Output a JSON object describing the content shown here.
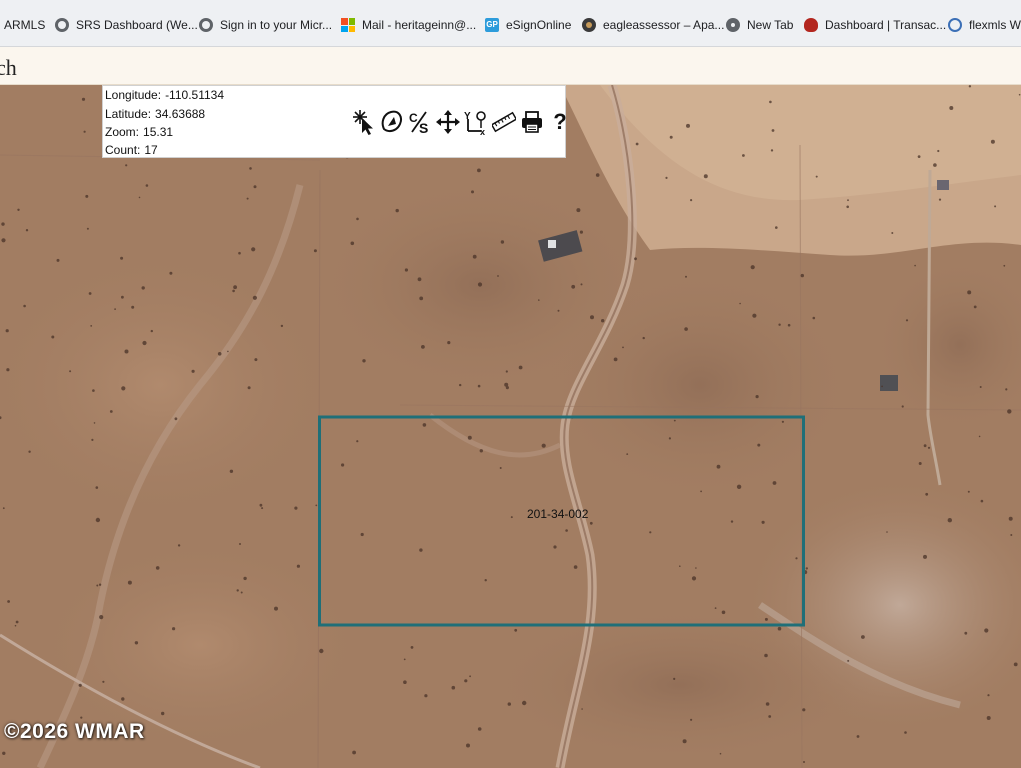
{
  "bookmarks": [
    {
      "label": "ARMLS",
      "icon": "none"
    },
    {
      "label": "SRS Dashboard (We...",
      "icon": "globe-icon"
    },
    {
      "label": "Sign in to your Micr...",
      "icon": "globe-icon"
    },
    {
      "label": "Mail - heritageinn@...",
      "icon": "microsoft-icon"
    },
    {
      "label": "eSignOnline",
      "icon": "gp-icon"
    },
    {
      "label": "eagleassessor – Apa...",
      "icon": "eagle-icon"
    },
    {
      "label": "New Tab",
      "icon": "chrome-icon"
    },
    {
      "label": "Dashboard | Transac...",
      "icon": "dashboard-icon"
    },
    {
      "label": "flexmls We",
      "icon": "flexmls-icon"
    }
  ],
  "page": {
    "title_fragment": "ch"
  },
  "map_info": {
    "longitude_label": "Longitude:",
    "longitude": "-110.51134",
    "latitude_label": "Latitude:",
    "latitude": "34.63688",
    "zoom_label": "Zoom:",
    "zoom": "15.31",
    "count_label": "Count:",
    "count": "17"
  },
  "toolbar": {
    "tools": [
      "identify-tool",
      "lasso-select-tool",
      "percent-tool",
      "pan-tool",
      "xy-coordinate-tool",
      "measure-tool",
      "print-tool",
      "help-tool"
    ],
    "help_label": "?"
  },
  "parcel": {
    "id": "201-34-002",
    "outline_color": "#1f6f78"
  },
  "watermark": "©2026 WMAR",
  "colors": {
    "terrain": "#a27d62",
    "light_terrain": "#c9a78a"
  }
}
